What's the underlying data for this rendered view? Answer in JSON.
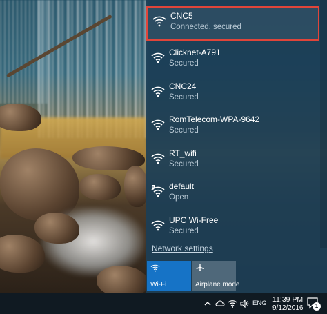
{
  "networks": [
    {
      "name": "CNC5",
      "status": "Connected, secured",
      "icon": "wifi-icon",
      "selected": true,
      "open": false
    },
    {
      "name": "Clicknet-A791",
      "status": "Secured",
      "icon": "wifi-icon",
      "selected": false,
      "open": false
    },
    {
      "name": "CNC24",
      "status": "Secured",
      "icon": "wifi-icon",
      "selected": false,
      "open": false
    },
    {
      "name": "RomTelecom-WPA-9642",
      "status": "Secured",
      "icon": "wifi-icon",
      "selected": false,
      "open": false
    },
    {
      "name": "RT_wifi",
      "status": "Secured",
      "icon": "wifi-icon",
      "selected": false,
      "open": false
    },
    {
      "name": "default",
      "status": "Open",
      "icon": "wifi-warning-icon",
      "selected": false,
      "open": true
    },
    {
      "name": "UPC Wi-Free",
      "status": "Secured",
      "icon": "wifi-icon",
      "selected": false,
      "open": false
    }
  ],
  "network_settings_label": "Network settings",
  "quick_actions": {
    "wifi": {
      "label": "Wi-Fi",
      "icon": "wifi-icon",
      "active": true
    },
    "airplane": {
      "label": "Airplane mode",
      "icon": "airplane-icon",
      "active": false
    }
  },
  "taskbar": {
    "language": "ENG",
    "time": "11:39 PM",
    "date": "9/12/2016",
    "notification_count": "1",
    "tray_icons": [
      "chevron-up-icon",
      "cloud-icon",
      "wifi-icon",
      "volume-icon"
    ]
  },
  "colors": {
    "flyout_bg": "#1c3e56",
    "accent": "#1673c6",
    "highlight_border": "#e0453a",
    "taskbar_bg": "#101a22"
  }
}
